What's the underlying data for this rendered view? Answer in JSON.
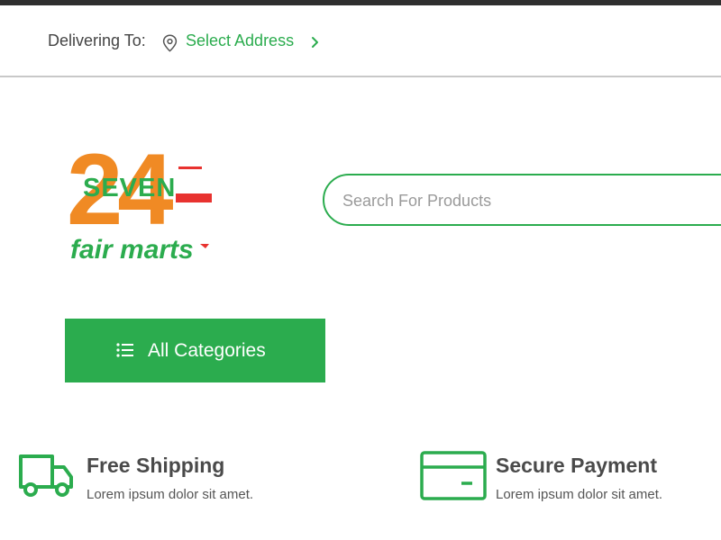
{
  "delivery": {
    "label": "Delivering To:",
    "select_address": "Select Address",
    "pin_icon": "location-pin-icon",
    "chevron_icon": "chevron-right-icon"
  },
  "logo": {
    "number": "24",
    "brand_word": "SEVEN",
    "tagline": "fair marts"
  },
  "search": {
    "placeholder": "Search For Products"
  },
  "categories": {
    "label": "All Categories",
    "icon": "list-icon"
  },
  "features": [
    {
      "title": "Free Shipping",
      "description": "Lorem ipsum dolor sit amet.",
      "icon": "truck-icon"
    },
    {
      "title": "Secure Payment",
      "description": "Lorem ipsum dolor sit amet.",
      "icon": "credit-card-icon"
    }
  ],
  "colors": {
    "accent_green": "#2bac4e",
    "logo_orange": "#f08a24",
    "logo_red": "#e8322f",
    "top_strip": "#2f2f2f"
  }
}
